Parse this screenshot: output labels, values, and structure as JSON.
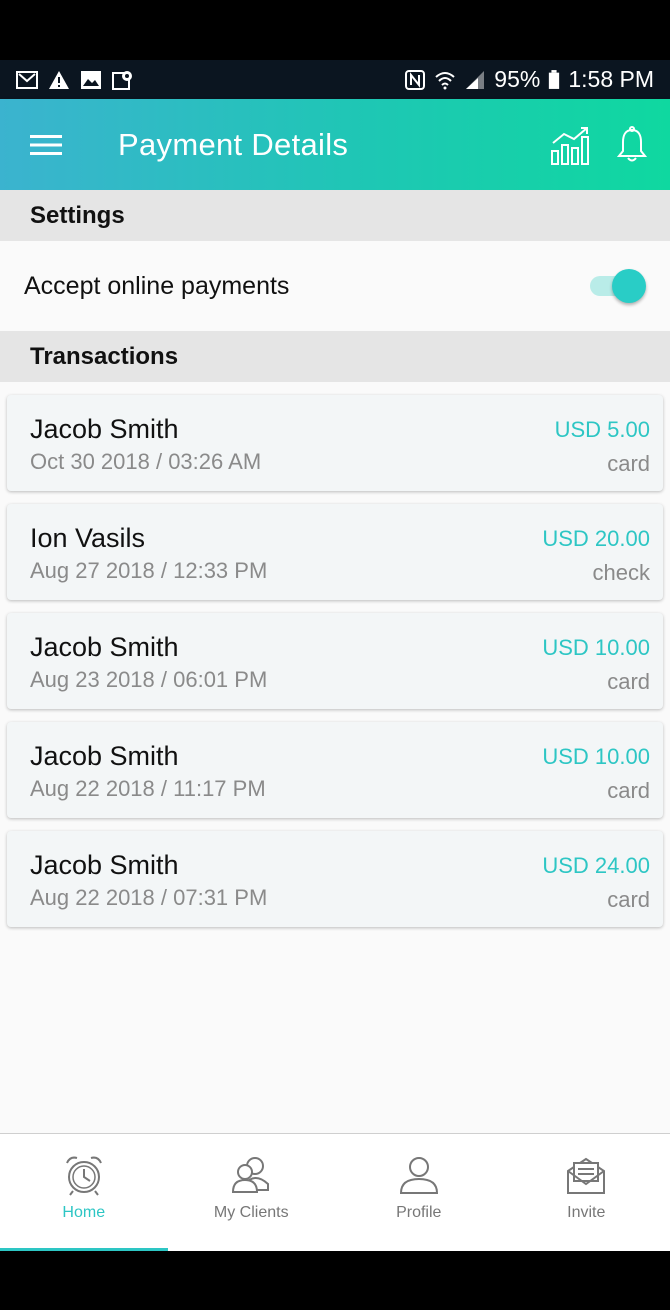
{
  "status_bar": {
    "battery": "95%",
    "time": "1:58 PM",
    "left_icons": [
      "gmail-icon",
      "warning-icon",
      "image-icon",
      "map-pin-icon"
    ],
    "right_icons": [
      "nfc-icon",
      "wifi-icon",
      "signal-icon",
      "battery-icon"
    ]
  },
  "app_bar": {
    "title": "Payment Details",
    "icons": [
      "menu-icon",
      "chart-icon",
      "bell-icon"
    ],
    "gradient": [
      "#3bb3cf",
      "#0fd8a0"
    ]
  },
  "settings": {
    "header": "Settings",
    "accept_online_payments": {
      "label": "Accept online payments",
      "enabled": true
    }
  },
  "transactions": {
    "header": "Transactions",
    "items": [
      {
        "name": "Jacob Smith",
        "date": "Oct 30 2018 / 03:26 AM",
        "amount": "USD 5.00",
        "method": "card"
      },
      {
        "name": "Ion Vasils",
        "date": "Aug 27 2018 / 12:33 PM",
        "amount": "USD 20.00",
        "method": "check"
      },
      {
        "name": "Jacob Smith",
        "date": "Aug 23 2018 / 06:01 PM",
        "amount": "USD 10.00",
        "method": "card"
      },
      {
        "name": "Jacob Smith",
        "date": "Aug 22 2018 / 11:17 PM",
        "amount": "USD 10.00",
        "method": "card"
      },
      {
        "name": "Jacob Smith",
        "date": "Aug 22 2018 / 07:31 PM",
        "amount": "USD 24.00",
        "method": "card"
      }
    ]
  },
  "bottom_nav": {
    "items": [
      {
        "label": "Home",
        "icon": "alarm-clock-icon",
        "active": true
      },
      {
        "label": "My Clients",
        "icon": "users-icon",
        "active": false
      },
      {
        "label": "Profile",
        "icon": "user-icon",
        "active": false
      },
      {
        "label": "Invite",
        "icon": "envelope-icon",
        "active": false
      }
    ]
  },
  "colors": {
    "accent": "#2dc6c4",
    "section_header_bg": "#e5e5e5",
    "muted_text": "#8a8a8a"
  }
}
